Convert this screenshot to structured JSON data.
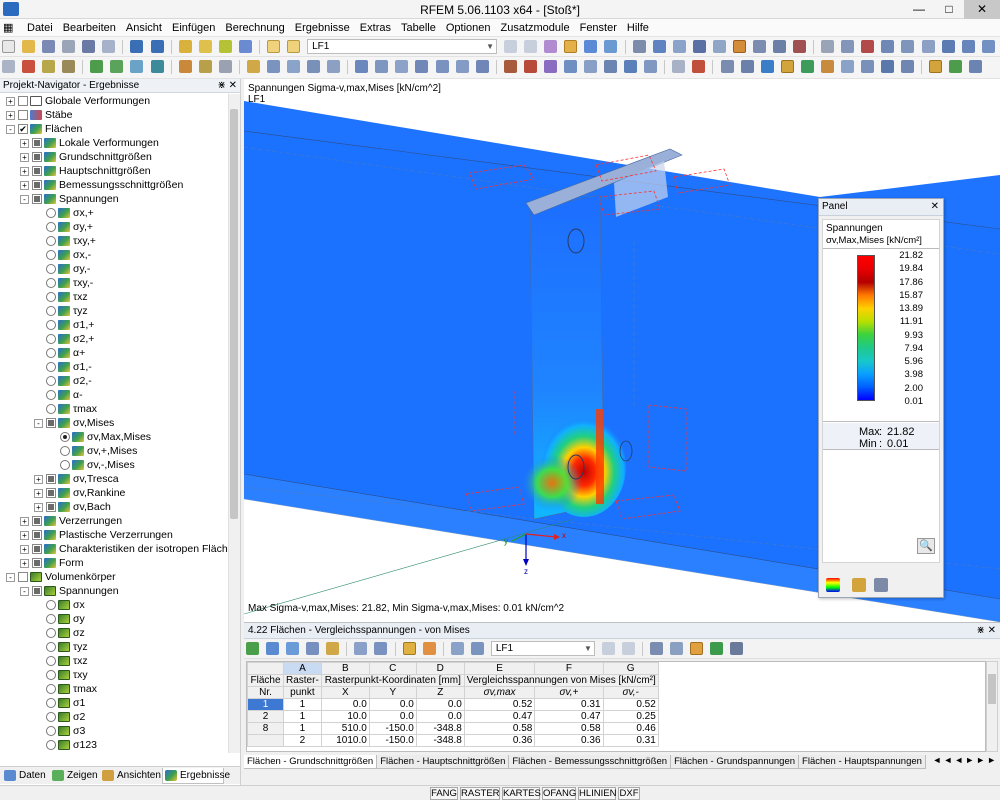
{
  "window": {
    "title": "RFEM 5.06.1103 x64 - [Stoß*]",
    "minimize": "—",
    "maximize": "□",
    "close": "✕"
  },
  "menu": [
    "Datei",
    "Bearbeiten",
    "Ansicht",
    "Einfügen",
    "Berechnung",
    "Ergebnisse",
    "Extras",
    "Tabelle",
    "Optionen",
    "Zusatzmodule",
    "Fenster",
    "Hilfe"
  ],
  "toolbar": {
    "loadcase": "LF1"
  },
  "navigator": {
    "title": "Projekt-Navigator - Ergebnisse",
    "items": [
      {
        "label": "Globale Verformungen",
        "level": 0,
        "exp": "+",
        "icon": "defm",
        "check": "box"
      },
      {
        "label": "Stäbe",
        "level": 0,
        "exp": "+",
        "icon": "bar",
        "check": "box"
      },
      {
        "label": "Flächen",
        "level": 0,
        "exp": "-",
        "icon": "surf",
        "check": "checked"
      },
      {
        "label": "Lokale Verformungen",
        "level": 1,
        "exp": "+",
        "icon": "surf",
        "check": "partial"
      },
      {
        "label": "Grundschnittgrößen",
        "level": 1,
        "exp": "+",
        "icon": "surf",
        "check": "partial"
      },
      {
        "label": "Hauptschnittgrößen",
        "level": 1,
        "exp": "+",
        "icon": "surf",
        "check": "partial"
      },
      {
        "label": "Bemessungsschnittgrößen",
        "level": 1,
        "exp": "+",
        "icon": "surf",
        "check": "partial"
      },
      {
        "label": "Spannungen",
        "level": 1,
        "exp": "-",
        "icon": "surf",
        "check": "partial"
      },
      {
        "label": "σx,+",
        "level": 2,
        "icon": "surf",
        "check": "radio"
      },
      {
        "label": "σy,+",
        "level": 2,
        "icon": "surf",
        "check": "radio"
      },
      {
        "label": "τxy,+",
        "level": 2,
        "icon": "surf",
        "check": "radio"
      },
      {
        "label": "σx,-",
        "level": 2,
        "icon": "surf",
        "check": "radio"
      },
      {
        "label": "σy,-",
        "level": 2,
        "icon": "surf",
        "check": "radio"
      },
      {
        "label": "τxy,-",
        "level": 2,
        "icon": "surf",
        "check": "radio"
      },
      {
        "label": "τxz",
        "level": 2,
        "icon": "surf",
        "check": "radio"
      },
      {
        "label": "τyz",
        "level": 2,
        "icon": "surf",
        "check": "radio"
      },
      {
        "label": "σ1,+",
        "level": 2,
        "icon": "surf",
        "check": "radio"
      },
      {
        "label": "σ2,+",
        "level": 2,
        "icon": "surf",
        "check": "radio"
      },
      {
        "label": "α+",
        "level": 2,
        "icon": "surf",
        "check": "radio"
      },
      {
        "label": "σ1,-",
        "level": 2,
        "icon": "surf",
        "check": "radio"
      },
      {
        "label": "σ2,-",
        "level": 2,
        "icon": "surf",
        "check": "radio"
      },
      {
        "label": "α-",
        "level": 2,
        "icon": "surf",
        "check": "radio"
      },
      {
        "label": "τmax",
        "level": 2,
        "icon": "surf",
        "check": "radio"
      },
      {
        "label": "σv,Mises",
        "level": 2,
        "exp": "-",
        "icon": "surf",
        "check": "partial"
      },
      {
        "label": "σv,Max,Mises",
        "level": 3,
        "icon": "surf",
        "check": "radio-on"
      },
      {
        "label": "σv,+,Mises",
        "level": 3,
        "icon": "surf",
        "check": "radio"
      },
      {
        "label": "σv,-,Mises",
        "level": 3,
        "icon": "surf",
        "check": "radio"
      },
      {
        "label": "σv,Tresca",
        "level": 2,
        "exp": "+",
        "icon": "surf",
        "check": "partial"
      },
      {
        "label": "σv,Rankine",
        "level": 2,
        "exp": "+",
        "icon": "surf",
        "check": "partial"
      },
      {
        "label": "σv,Bach",
        "level": 2,
        "exp": "+",
        "icon": "surf",
        "check": "partial"
      },
      {
        "label": "Verzerrungen",
        "level": 1,
        "exp": "+",
        "icon": "surf",
        "check": "partial"
      },
      {
        "label": "Plastische Verzerrungen",
        "level": 1,
        "exp": "+",
        "icon": "surf",
        "check": "partial"
      },
      {
        "label": "Charakteristiken der isotropen Fläche",
        "level": 1,
        "exp": "+",
        "icon": "surf",
        "check": "partial"
      },
      {
        "label": "Form",
        "level": 1,
        "exp": "+",
        "icon": "surf",
        "check": "partial"
      },
      {
        "label": "Volumenkörper",
        "level": 0,
        "exp": "-",
        "icon": "solid",
        "check": "box"
      },
      {
        "label": "Spannungen",
        "level": 1,
        "exp": "-",
        "icon": "solid",
        "check": "partial"
      },
      {
        "label": "σx",
        "level": 2,
        "icon": "solid",
        "check": "radio"
      },
      {
        "label": "σy",
        "level": 2,
        "icon": "solid",
        "check": "radio"
      },
      {
        "label": "σz",
        "level": 2,
        "icon": "solid",
        "check": "radio"
      },
      {
        "label": "τyz",
        "level": 2,
        "icon": "solid",
        "check": "radio"
      },
      {
        "label": "τxz",
        "level": 2,
        "icon": "solid",
        "check": "radio"
      },
      {
        "label": "τxy",
        "level": 2,
        "icon": "solid",
        "check": "radio"
      },
      {
        "label": "τmax",
        "level": 2,
        "icon": "solid",
        "check": "radio"
      },
      {
        "label": "σ1",
        "level": 2,
        "icon": "solid",
        "check": "radio"
      },
      {
        "label": "σ2",
        "level": 2,
        "icon": "solid",
        "check": "radio"
      },
      {
        "label": "σ3",
        "level": 2,
        "icon": "solid",
        "check": "radio"
      },
      {
        "label": "σ123",
        "level": 2,
        "icon": "solid",
        "check": "radio"
      }
    ],
    "tabs": [
      "Daten",
      "Zeigen",
      "Ansichten",
      "Ergebnisse"
    ]
  },
  "viewport": {
    "caption": "Spannungen Sigma-v,max,Mises [kN/cm^2]",
    "loadcase": "LF1",
    "footer": "Max Sigma-v,max,Mises: 21.82, Min Sigma-v,max,Mises: 0.01 kN/cm^2",
    "axes": {
      "x": "x",
      "y": "y",
      "z": "z"
    }
  },
  "panel": {
    "title": "Panel",
    "heading": "Spannungen",
    "subheading": "σv,Max,Mises [kN/cm²]",
    "legend": [
      "21.82",
      "19.84",
      "17.86",
      "15.87",
      "13.89",
      "11.91",
      "9.93",
      "7.94",
      "5.96",
      "3.98",
      "2.00",
      "0.01"
    ],
    "colors": [
      "#ff0000",
      "#e80000",
      "#b40000",
      "#ff7a00",
      "#ffd000",
      "#b8e000",
      "#3cd23c",
      "#1fc98a",
      "#18c8c8",
      "#0aa0ff",
      "#0060ff",
      "#0000ff"
    ],
    "max_label": "Max",
    "max_value": "21.82",
    "min_label": "Min",
    "min_value": "0.01",
    "sep": ":"
  },
  "table": {
    "title": "4.22 Flächen - Vergleichsspannungen - von Mises",
    "loadcase": "LF1",
    "col_letters": [
      "A",
      "B",
      "C",
      "D",
      "E",
      "F",
      "G"
    ],
    "head1": {
      "flaeche": "Fläche",
      "raster": "Raster-",
      "coords": "Rasterpunkt-Koordinaten [mm]",
      "mises": "Vergleichsspannungen von Mises [kN/cm²]"
    },
    "head2": {
      "nr": "Nr.",
      "punkt": "punkt",
      "x": "X",
      "y": "Y",
      "z": "Z",
      "smax": "σv,max",
      "splus": "σv,+",
      "sminus": "σv,-"
    },
    "rows": [
      {
        "flaeche": "1",
        "punkt": "1",
        "x": "0.0",
        "y": "0.0",
        "z": "0.0",
        "smax": "0.52",
        "splus": "0.31",
        "sminus": "0.52"
      },
      {
        "flaeche": "2",
        "punkt": "1",
        "x": "10.0",
        "y": "0.0",
        "z": "0.0",
        "smax": "0.47",
        "splus": "0.47",
        "sminus": "0.25"
      },
      {
        "flaeche": "8",
        "punkt": "1",
        "x": "510.0",
        "y": "-150.0",
        "z": "-348.8",
        "smax": "0.58",
        "splus": "0.58",
        "sminus": "0.46"
      },
      {
        "flaeche": "",
        "punkt": "2",
        "x": "1010.0",
        "y": "-150.0",
        "z": "-348.8",
        "smax": "0.36",
        "splus": "0.36",
        "sminus": "0.31"
      }
    ],
    "sheet_tabs": [
      "Flächen - Grundschnittgrößen",
      "Flächen - Hauptschnittgrößen",
      "Flächen - Bemessungsschnittgrößen",
      "Flächen - Grundspannungen",
      "Flächen - Hauptspannungen"
    ]
  },
  "status": [
    "FANG",
    "RASTER",
    "KARTES",
    "OFANG",
    "HLINIEN",
    "DXF"
  ]
}
